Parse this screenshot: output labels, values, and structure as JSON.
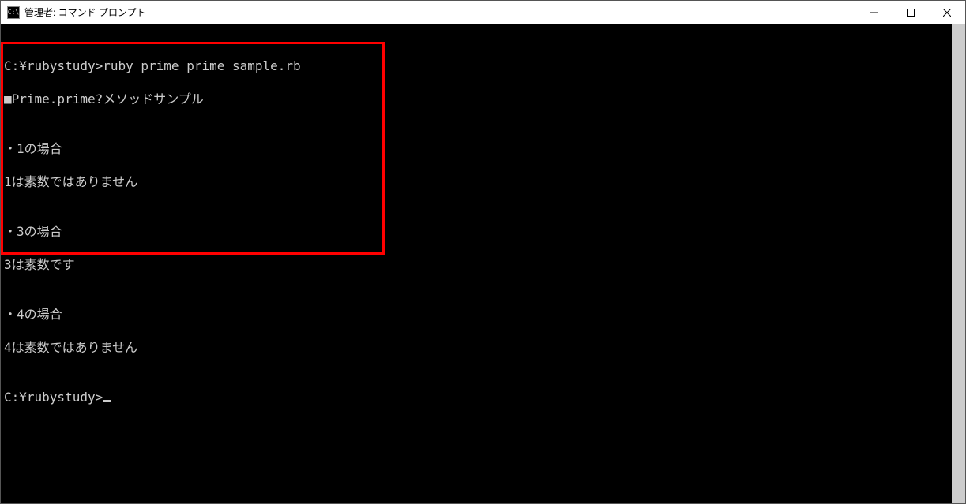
{
  "window": {
    "title": "管理者: コマンド プロンプト",
    "icon_label": "C:\\"
  },
  "terminal": {
    "lines": [
      "",
      "C:¥rubystudy>ruby prime_prime_sample.rb",
      "■Prime.prime?メソッドサンプル",
      "",
      "・1の場合",
      "1は素数ではありません",
      "",
      "・3の場合",
      "3は素数です",
      "",
      "・4の場合",
      "4は素数ではありません",
      "",
      "C:¥rubystudy>"
    ]
  }
}
